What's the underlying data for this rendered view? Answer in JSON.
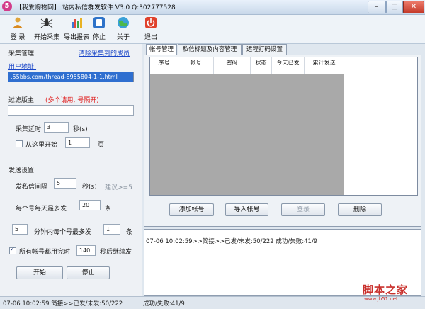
{
  "window": {
    "app_icon": "5",
    "title": "【我爱购物网】 站内私信群发软件 V3.0  Q:302777528",
    "minimize": "–",
    "maximize": "□",
    "close": "✕"
  },
  "toolbar": {
    "items": [
      {
        "label": "登 录",
        "icon": "user-login-icon"
      },
      {
        "label": "开始采集",
        "icon": "spider-icon"
      },
      {
        "label": "导出报表",
        "icon": "bar-chart-icon"
      },
      {
        "label": "停止",
        "icon": "stop-icon"
      },
      {
        "label": "关于",
        "icon": "globe-icon"
      },
      {
        "label": "退出",
        "icon": "power-icon"
      }
    ]
  },
  "collect": {
    "section_title": "采集管理",
    "clear_link": "清除采集到的成员",
    "url_label": "用户地址:",
    "url_value": ".55bbs.com/thread-8955804-1-1.html",
    "filter_label": "过滤版主:",
    "filter_hint": "(多个请用, 号隔开)",
    "filter_value": "",
    "delay_label": "采集延时",
    "delay_value": "3",
    "delay_unit": "秒(s)",
    "start_here_label": "从这里开始",
    "start_here_checked": false,
    "start_page_value": "1",
    "page_unit": "页"
  },
  "send": {
    "section_title": "发送设置",
    "interval_label": "发私信间隔",
    "interval_value": "5",
    "interval_unit": "秒(s)",
    "interval_hint": "建议>=5",
    "daily_label": "每个号每天最多发",
    "daily_value": "20",
    "daily_unit": "条",
    "per_min_value": "5",
    "per_min_label": "分钟内每个号最多发",
    "per_min_count": "1",
    "per_min_unit": "条",
    "continue_label": "所有帐号都用完时",
    "continue_checked": true,
    "continue_value": "140",
    "continue_suffix": "秒后继续发",
    "start_button": "开始",
    "stop_button": "停止"
  },
  "tabs": [
    {
      "label": "帐号管理",
      "active": true
    },
    {
      "label": "私信标题及内容管理",
      "active": false
    },
    {
      "label": "远程打码设置",
      "active": false
    }
  ],
  "accounts": {
    "columns": [
      "序号",
      "帐号",
      "密码",
      "状态",
      "今天已发",
      "累计发送"
    ],
    "rows": [],
    "buttons": {
      "add": "添加帐号",
      "import": "导入帐号",
      "login": "登录",
      "delete": "删除"
    }
  },
  "log": {
    "line": "07-06 10:02:59>>简接>>已发/未发:50/222    成功/失败:41/9"
  },
  "status": {
    "time_text": "07-06 10:02:59 简接>>已发/未发:50/222",
    "result_text": "成功/失败:41/9"
  },
  "watermark": {
    "text": "脚本之家",
    "url": "www.jb51.net"
  },
  "colors": {
    "link": "#1a46c8",
    "hint_red": "#e02020",
    "list_grey": "#a9a9a9",
    "url_highlight": "#2f6fd0"
  }
}
